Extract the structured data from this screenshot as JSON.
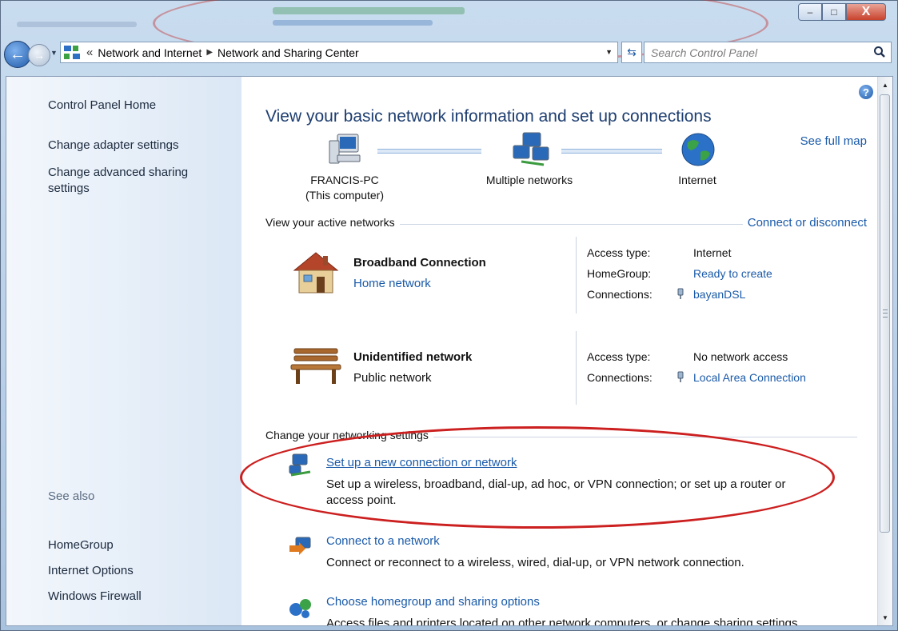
{
  "window": {
    "controls": {
      "minimize": "–",
      "maximize": "□",
      "close": "X"
    }
  },
  "nav": {
    "back_glyph": "←",
    "forward_glyph": "→",
    "breadcrumb_prefix": "«",
    "breadcrumb": [
      "Network and Internet",
      "Network and Sharing Center"
    ],
    "refresh_glyph": "⇆",
    "search_placeholder": "Search Control Panel"
  },
  "sidebar": {
    "items": [
      "Control Panel Home",
      "Change adapter settings",
      "Change advanced sharing settings"
    ],
    "see_also_heading": "See also",
    "see_also": [
      "HomeGroup",
      "Internet Options",
      "Windows Firewall"
    ]
  },
  "main": {
    "help_glyph": "?",
    "title": "View your basic network information and set up connections",
    "see_full_map": "See full map",
    "map": {
      "computer": {
        "name": "FRANCIS-PC",
        "sub": "(This computer)"
      },
      "network": {
        "name": "Multiple networks"
      },
      "internet": {
        "name": "Internet"
      }
    },
    "active_networks_heading": "View your active networks",
    "connect_or_disconnect": "Connect or disconnect",
    "networks": [
      {
        "name": "Broadband Connection",
        "category": "Home network",
        "access_type_label": "Access type:",
        "access_type": "Internet",
        "homegroup_label": "HomeGroup:",
        "homegroup": "Ready to create",
        "connections_label": "Connections:",
        "connection": "bayanDSL"
      },
      {
        "name": "Unidentified network",
        "category": "Public network",
        "access_type_label": "Access type:",
        "access_type": "No network access",
        "connections_label": "Connections:",
        "connection": "Local Area Connection"
      }
    ],
    "change_settings_heading": "Change your networking settings",
    "tasks": [
      {
        "title": "Set up a new connection or network",
        "desc": "Set up a wireless, broadband, dial-up, ad hoc, or VPN connection; or set up a router or access point."
      },
      {
        "title": "Connect to a network",
        "desc": "Connect or reconnect to a wireless, wired, dial-up, or VPN network connection."
      },
      {
        "title": "Choose homegroup and sharing options",
        "desc": "Access files and printers located on other network computers, or change sharing settings."
      }
    ]
  },
  "colors": {
    "link": "#1a5aa9",
    "title": "#1e3e70",
    "highlight_ellipse": "#cc1f1f",
    "chrome": "#b7cfe8"
  }
}
